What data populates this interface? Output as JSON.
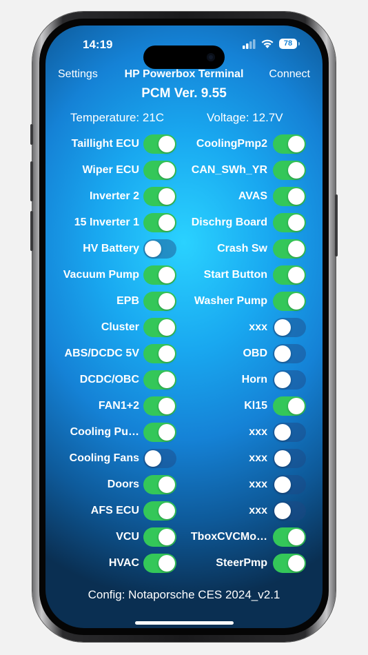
{
  "status": {
    "time": "14:19",
    "battery": "78"
  },
  "nav": {
    "settings": "Settings",
    "title": "HP Powerbox Terminal",
    "connect": "Connect"
  },
  "version": "PCM Ver. 9.55",
  "readings": {
    "temperature": "Temperature: 21C",
    "voltage": "Voltage: 12.7V"
  },
  "left": [
    {
      "label": "Taillight ECU",
      "on": true
    },
    {
      "label": "Wiper ECU",
      "on": true
    },
    {
      "label": "Inverter 2",
      "on": true
    },
    {
      "label": "15 Inverter 1",
      "on": true
    },
    {
      "label": "HV Battery",
      "on": false
    },
    {
      "label": "Vacuum Pump",
      "on": true
    },
    {
      "label": "EPB",
      "on": true
    },
    {
      "label": "Cluster",
      "on": true
    },
    {
      "label": "ABS/DCDC 5V",
      "on": true
    },
    {
      "label": "DCDC/OBC",
      "on": true
    },
    {
      "label": "FAN1+2",
      "on": true
    },
    {
      "label": "Cooling Pu…",
      "on": true
    },
    {
      "label": "Cooling Fans",
      "on": false
    },
    {
      "label": "Doors",
      "on": true
    },
    {
      "label": "AFS ECU",
      "on": true
    },
    {
      "label": "VCU",
      "on": true
    },
    {
      "label": "HVAC",
      "on": true
    }
  ],
  "right": [
    {
      "label": "CoolingPmp2",
      "on": true
    },
    {
      "label": "CAN_SWh_YR",
      "on": true
    },
    {
      "label": "AVAS",
      "on": true
    },
    {
      "label": "Dischrg Board",
      "on": true
    },
    {
      "label": "Crash Sw",
      "on": true
    },
    {
      "label": "Start Button",
      "on": true
    },
    {
      "label": "Washer Pump",
      "on": true
    },
    {
      "label": "xxx",
      "on": false
    },
    {
      "label": "OBD",
      "on": false
    },
    {
      "label": "Horn",
      "on": false
    },
    {
      "label": "Kl15",
      "on": true
    },
    {
      "label": "xxx",
      "on": false
    },
    {
      "label": "xxx",
      "on": false
    },
    {
      "label": "xxx",
      "on": false
    },
    {
      "label": "xxx",
      "on": false
    },
    {
      "label": "TboxCVCMo…",
      "on": true
    },
    {
      "label": "SteerPmp",
      "on": true
    }
  ],
  "config": "Config: Notaporsche CES 2024_v2.1",
  "colors": {
    "on": "#34c759",
    "off": "#1e4682",
    "accent": "#1faaf0"
  }
}
